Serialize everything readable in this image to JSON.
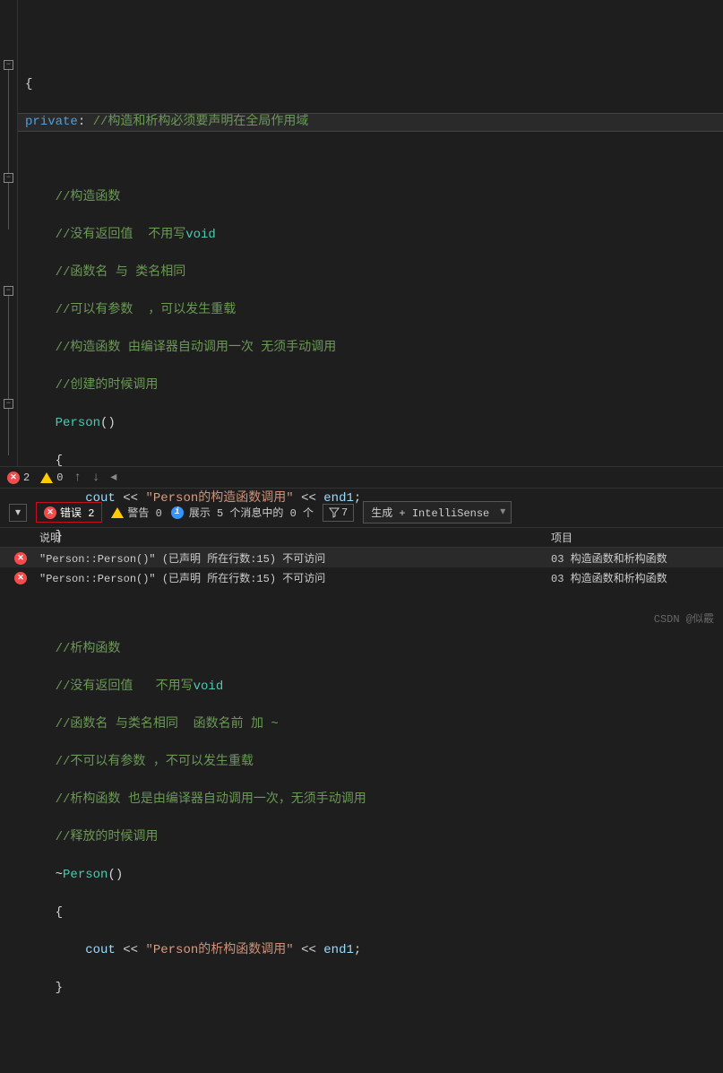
{
  "code": {
    "brace_open": "{",
    "private_kw": "private",
    "colon": ":",
    "comment_scope": " //构造和析构必须要声明在全局作用域",
    "ctor_section": {
      "c1": "//构造函数",
      "c2_a": "//没有返回值  不用写",
      "c2_void": "void",
      "c3": "//函数名 与 类名相同",
      "c4": "//可以有参数  ，可以发生重载",
      "c5": "//构造函数 由编译器自动调用一次 无须手动调用",
      "c6": "//创建的时候调用",
      "name": "Person",
      "parens": "()",
      "brace_open": "{",
      "cout": "cout",
      "op": " << ",
      "str_q1": "\"",
      "str_class": "Person",
      "str_rest": "的构造函数调用",
      "str_q2": "\"",
      "endl": "end1",
      "semi": ";",
      "brace_close": "}"
    },
    "dtor_section": {
      "c1": "//析构函数",
      "c2_a": "//没有返回值   不用写",
      "c2_void": "void",
      "c3": "//函数名 与类名相同  函数名前 加 ~",
      "c4": "//不可以有参数 ，不可以发生重载",
      "c5": "//析构函数 也是由编译器自动调用一次，无须手动调用",
      "c6": "//释放的时候调用",
      "tilde": "~",
      "name": "Person",
      "parens": "()",
      "brace_open": "{",
      "cout": "cout",
      "op": " << ",
      "str_q1": "\"",
      "str_class": "Person",
      "str_rest": "的析构函数调用",
      "str_q2": "\"",
      "endl": "end1",
      "semi": ";",
      "brace_close": "}"
    }
  },
  "statusbar": {
    "errors": "2",
    "warnings": "0"
  },
  "errorlist": {
    "errors_label": "错误 2",
    "warnings_label": "警告 0",
    "info_label": "展示 5 个消息中的 0 个",
    "filter_badge": "7",
    "build_label": "生成 + IntelliSense",
    "col_desc": "说明",
    "col_proj": "项目",
    "rows": [
      {
        "desc": "\"Person::Person()\" (已声明 所在行数:15) 不可访问",
        "proj": "03 构造函数和析构函数"
      },
      {
        "desc": "\"Person::Person()\" (已声明 所在行数:15) 不可访问",
        "proj": "03 构造函数和析构函数"
      }
    ]
  },
  "watermark": "CSDN @似霰"
}
